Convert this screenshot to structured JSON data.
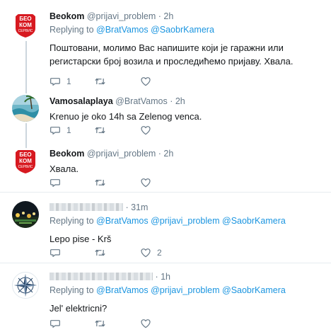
{
  "tweets": [
    {
      "name": "Beokom",
      "handle": "@prijavi_problem",
      "sep": " · ",
      "time": "2h",
      "reply_prefix": "Replying to ",
      "reply_to": "@BratVamos @SaobrKamera",
      "body": "Поштовани, молимо Вас напишите који је гаражни или регистарски број возила и проследићемо пријаву. Хвала.",
      "reply_count": "1",
      "retweet_count": "",
      "like_count": "",
      "avatar_text": [
        "БЕО",
        "КОМ",
        "СЕРВИС"
      ],
      "avatar_color": "#d71920"
    },
    {
      "name": "Vamosalaplaya",
      "handle": "@BratVamos",
      "sep": " · ",
      "time": "2h",
      "body": "Krenuo je oko 14h sa Zelenog venca.",
      "reply_count": "1",
      "retweet_count": "",
      "like_count": ""
    },
    {
      "name": "Beokom",
      "handle": "@prijavi_problem",
      "sep": " · ",
      "time": "2h",
      "body": "Хвала.",
      "reply_count": "",
      "retweet_count": "",
      "like_count": "",
      "avatar_text": [
        "БЕО",
        "КОМ",
        "СЕРВИС"
      ]
    },
    {
      "name_hidden": true,
      "sep": " · ",
      "time": "31m",
      "reply_prefix": "Replying to ",
      "reply_to": "@BratVamos @prijavi_problem @SaobrKamera",
      "body": "Lepo pise - Krš",
      "reply_count": "",
      "retweet_count": "",
      "like_count": "2"
    },
    {
      "name_hidden": true,
      "sep": " · ",
      "time": "1h",
      "reply_prefix": "Replying to ",
      "reply_to": "@BratVamos @prijavi_problem @SaobrKamera",
      "body": "Jel' elektricni?",
      "reply_count": "",
      "retweet_count": "",
      "like_count": ""
    }
  ],
  "icons": {
    "reply": "reply-icon",
    "retweet": "retweet-icon",
    "like": "like-icon"
  },
  "colors": {
    "link": "#1b95e0",
    "muted": "#657786",
    "text": "#14171a"
  }
}
